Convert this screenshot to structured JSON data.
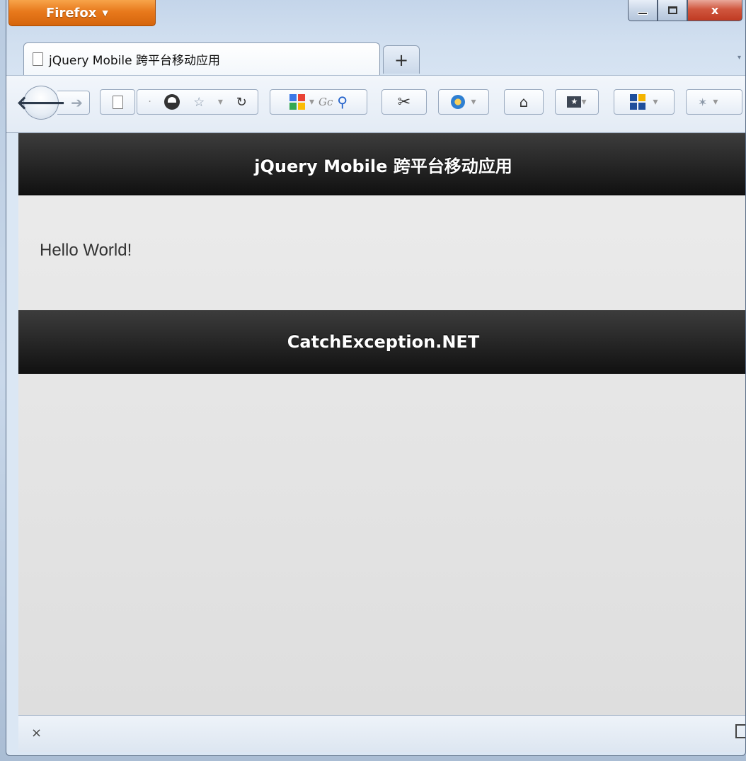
{
  "window": {
    "firefox_button_label": "Firefox",
    "caption": {
      "close_label": "x"
    }
  },
  "tabs": [
    {
      "title": "jQuery Mobile 跨平台移动应用",
      "active": true
    }
  ],
  "tabstrip": {
    "new_tab_label": "+"
  },
  "toolbar": {
    "search_hint": "Gc",
    "icons": [
      "back-icon",
      "forward-icon",
      "page-icon",
      "site-identity-icon",
      "bookmark-star-icon",
      "dropdown-icon",
      "reload-icon",
      "google-search-engine-icon",
      "search-icon",
      "screenshot-scissors-icon",
      "addon-badge-icon",
      "home-icon",
      "bookmarks-menu-icon",
      "tiles-addon-icon",
      "extension-icon"
    ]
  },
  "page": {
    "header_title": "jQuery Mobile 跨平台移动应用",
    "content_text": "Hello World!",
    "footer_title": "CatchException.NET"
  },
  "statusbar": {
    "close_label": "×"
  },
  "colors": {
    "firefox_orange": "#e8791c",
    "jqm_bar": "#1c1c1c",
    "page_background": "#e6e6e6"
  }
}
